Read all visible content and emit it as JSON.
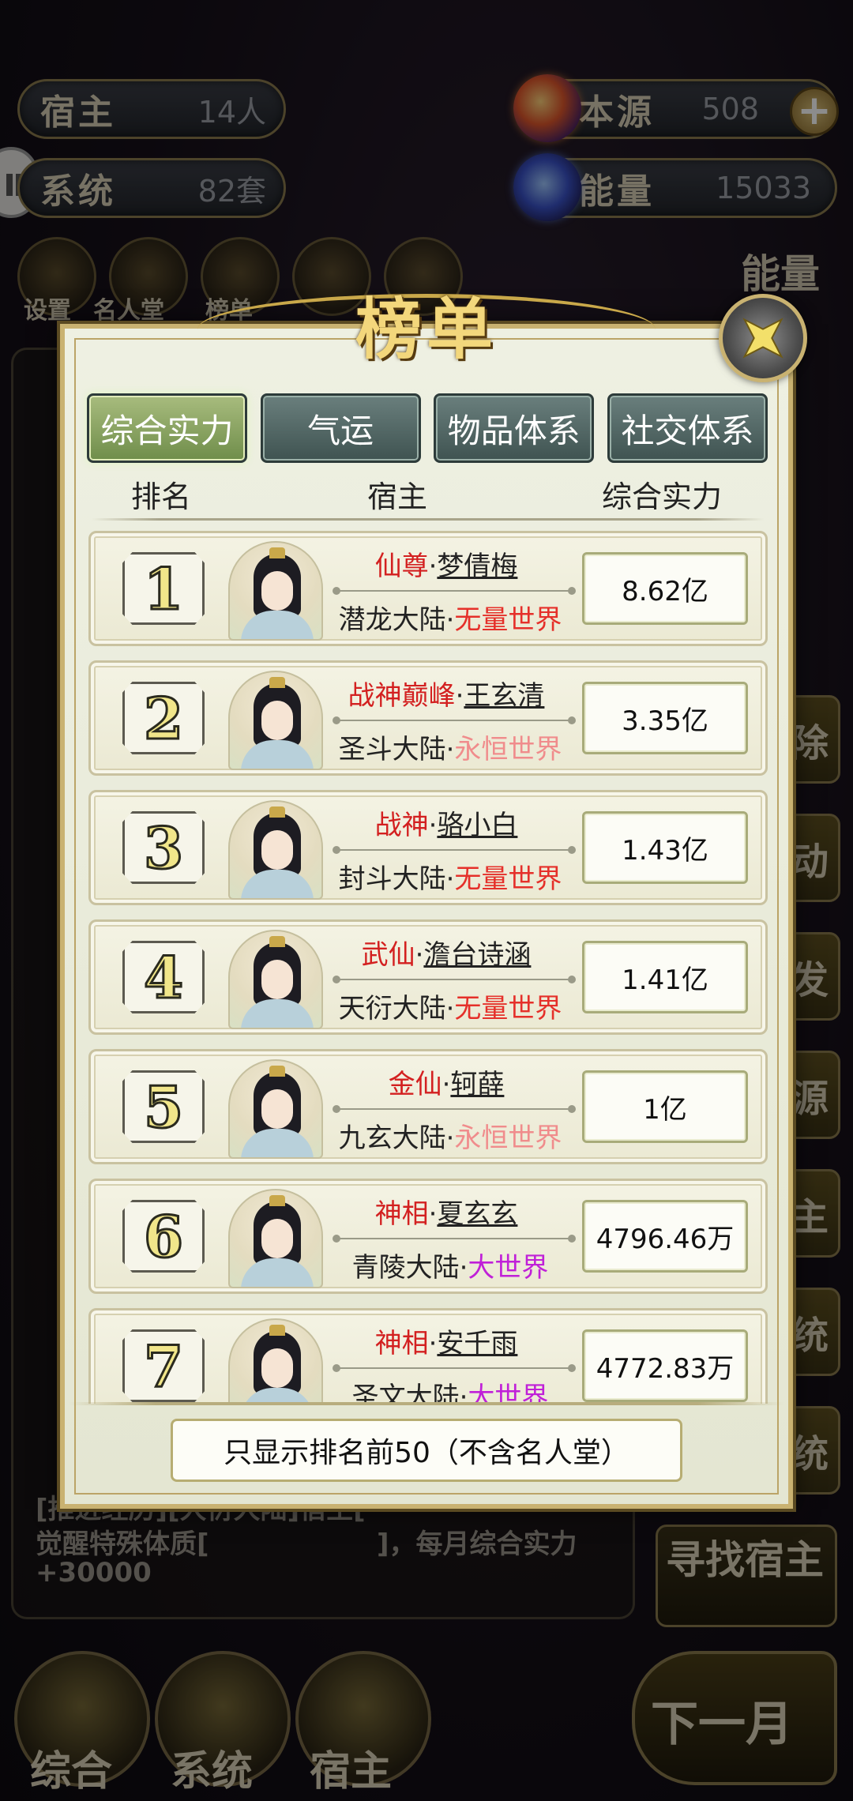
{
  "resources": {
    "host": {
      "label": "宿主",
      "value": "14人"
    },
    "origin": {
      "label": "本源",
      "value": "508"
    },
    "system": {
      "label": "系统",
      "value": "82套"
    },
    "energy": {
      "label": "能量",
      "value": "15033"
    }
  },
  "background": {
    "menu_labels": [
      "设置",
      "名人堂",
      "榜单"
    ],
    "energy_pack": "能量包",
    "side_buttons": [
      "除",
      "动",
      "发",
      "源",
      "主",
      "统",
      "统"
    ],
    "log_line": "[推进经历][大衍大陆]宿主[",
    "log_line2": "觉醒特殊体质[",
    "log_line3": "]，每月综合实力",
    "log_line4": "+30000",
    "find_host": "寻找宿主",
    "next_month": "下一月",
    "bottom_nav": [
      "综合",
      "系统",
      "宿主"
    ]
  },
  "modal": {
    "title": "榜单",
    "tabs": [
      "综合实力",
      "气运",
      "物品体系",
      "社交体系"
    ],
    "active_tab": 0,
    "columns": [
      "排名",
      "宿主",
      "综合实力"
    ],
    "rows": [
      {
        "rank": "1",
        "title": "仙尊",
        "name": "梦倩梅",
        "continent": "潜龙大陆",
        "world": "无量世界",
        "world_style": "red",
        "power": "8.62亿"
      },
      {
        "rank": "2",
        "title": "战神巅峰",
        "name": "王玄清",
        "continent": "圣斗大陆",
        "world": "永恒世界",
        "world_style": "pink",
        "power": "3.35亿"
      },
      {
        "rank": "3",
        "title": "战神",
        "name": "骆小白",
        "continent": "封斗大陆",
        "world": "无量世界",
        "world_style": "red",
        "power": "1.43亿"
      },
      {
        "rank": "4",
        "title": "武仙",
        "name": "澹台诗涵",
        "continent": "天衍大陆",
        "world": "无量世界",
        "world_style": "red",
        "power": "1.41亿"
      },
      {
        "rank": "5",
        "title": "金仙",
        "name": "轲薛",
        "continent": "九玄大陆",
        "world": "永恒世界",
        "world_style": "pink",
        "power": "1亿"
      },
      {
        "rank": "6",
        "title": "神相",
        "name": "夏玄玄",
        "continent": "青陵大陆",
        "world": "大世界",
        "world_style": "purple",
        "power": "4796.46万"
      },
      {
        "rank": "7",
        "title": "神相",
        "name": "安千雨",
        "continent": "圣文大陆",
        "world": "大世界",
        "world_style": "purple",
        "power": "4772.83万"
      }
    ],
    "footer_note": "只显示排名前50（不含名人堂）"
  },
  "colors": {
    "title_red": "#d32020",
    "world_red": "#e5302a",
    "world_pink": "#f08c8c",
    "world_purple": "#c020d8",
    "tab_active": "#8fa861",
    "tab_inactive": "#546a68"
  }
}
